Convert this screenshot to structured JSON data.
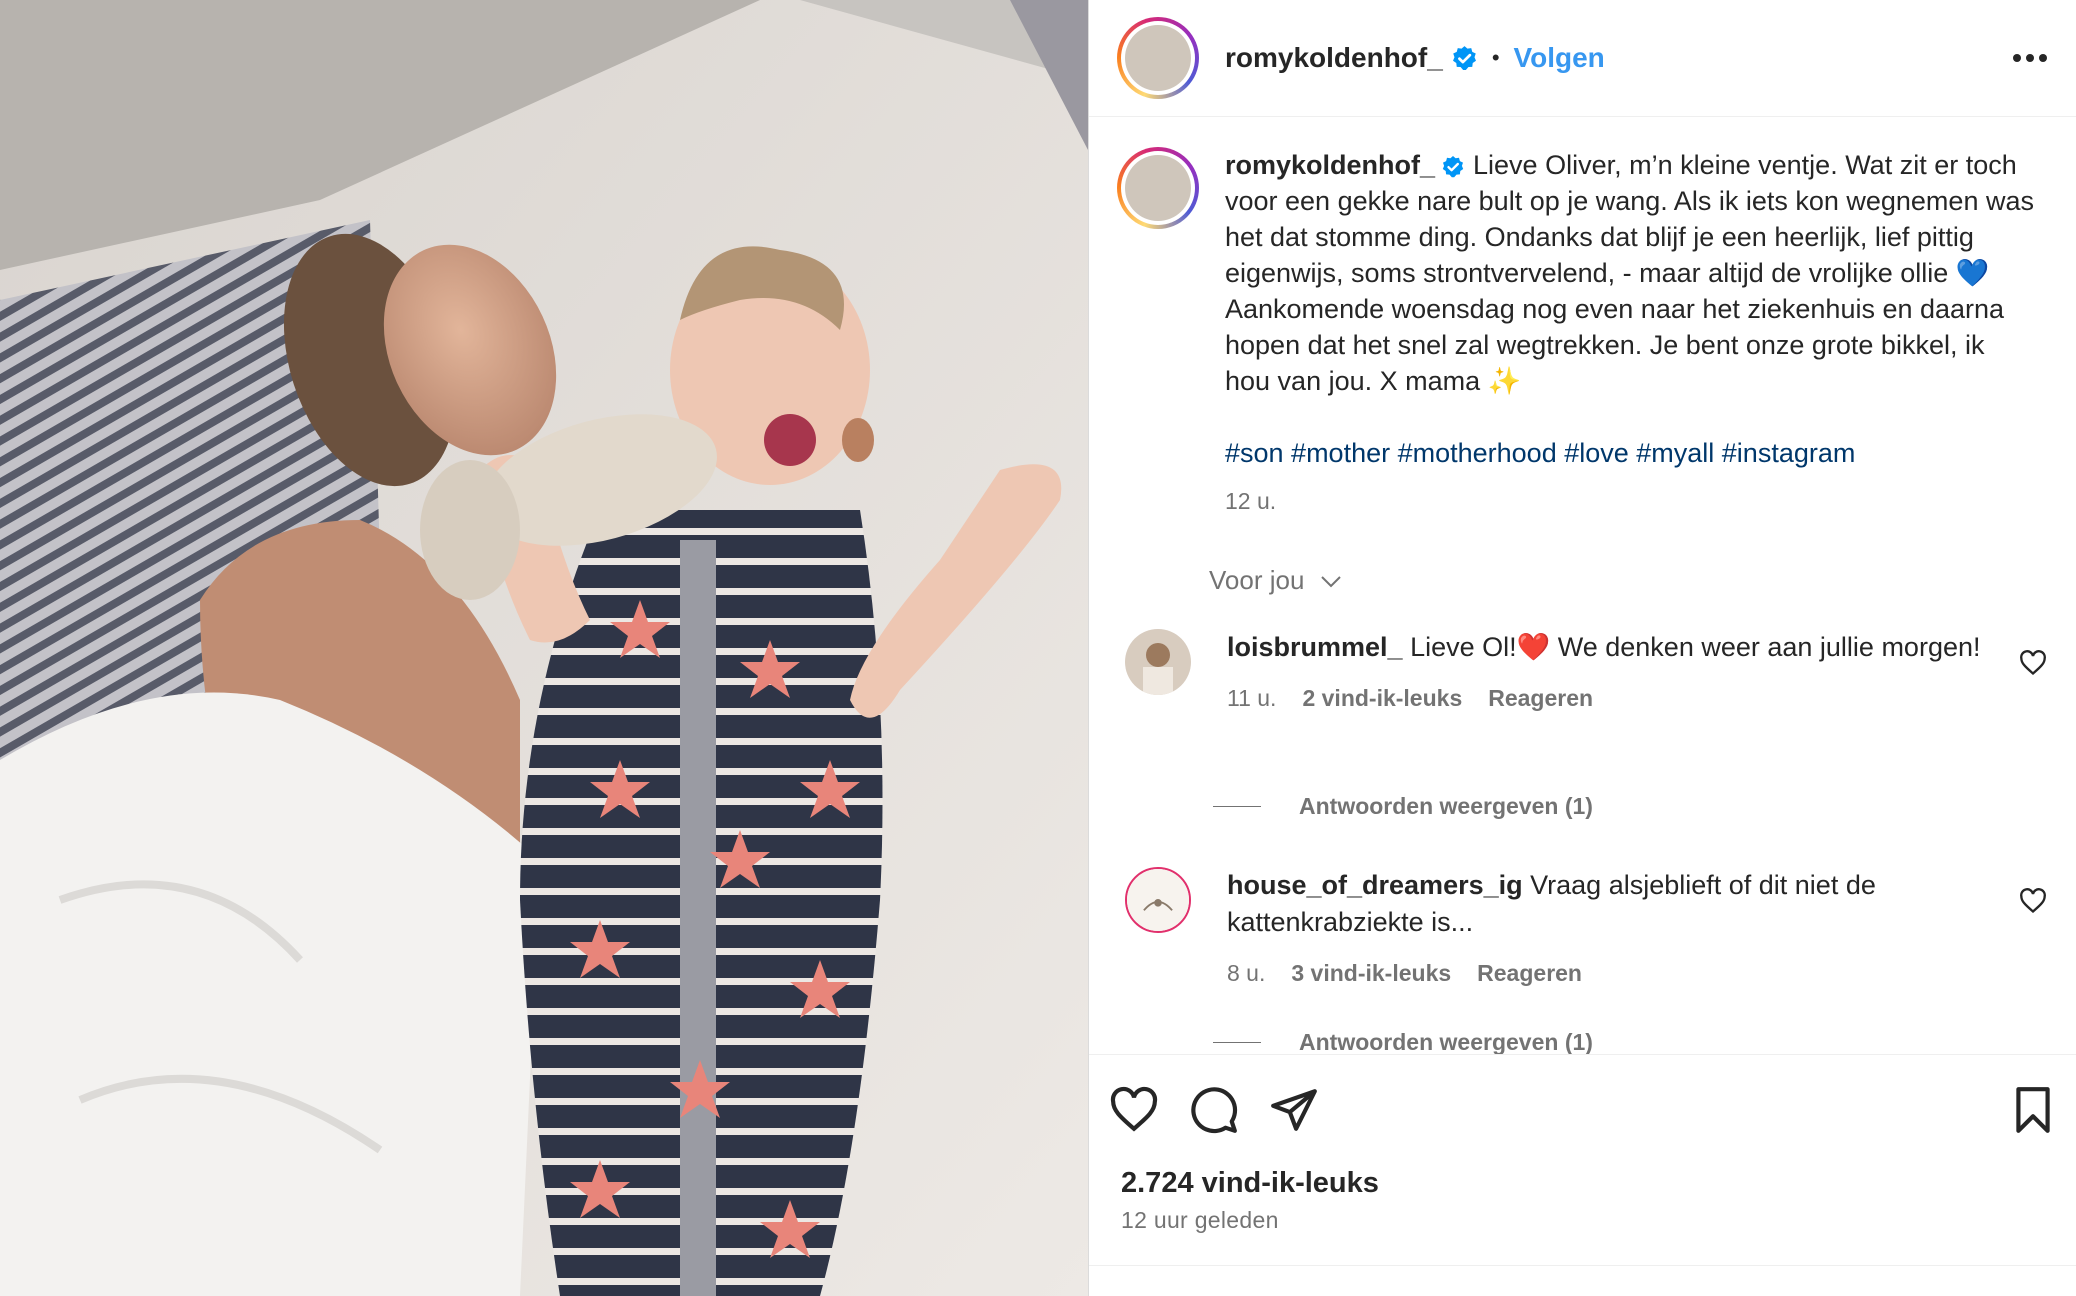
{
  "post": {
    "username": "romykoldenhof_",
    "verified": true,
    "separator": "•",
    "follow_label": "Volgen",
    "more_label": "•••"
  },
  "caption": {
    "username": "romykoldenhof_",
    "text": "Lieve Oliver, m’n kleine ventje. Wat zit er toch voor een gekke nare bult op je wang. Als ik iets kon wegnemen was het dat stomme ding. Ondanks dat blijf je een heerlijk, lief pittig eigenwijs, soms strontvervelend, - maar altijd de vrolijke ollie 💙 Aankomende woensdag nog even naar het ziekenhuis en daarna hopen dat het snel zal wegtrekken. Je bent onze grote bikkel, ik hou van jou. X mama ✨",
    "hashtags": "#son #mother #motherhood #love #myall #instagram",
    "time": "12 u."
  },
  "for_you": {
    "label": "Voor jou",
    "chevron": "⌵"
  },
  "comments": [
    {
      "username": "loisbrummel_",
      "text": "Lieve Ol!❤️ We denken weer aan jullie morgen!",
      "time": "11 u.",
      "likes": "2 vind-ik-leuks",
      "reply": "Reageren",
      "view_replies": "Antwoorden weergeven (1)"
    },
    {
      "username": "house_of_dreamers_ig",
      "text": "Vraag alsjeblieft of dit niet de kattenkrabziekte is...",
      "time": "8 u.",
      "likes": "3 vind-ik-leuks",
      "reply": "Reageren",
      "view_replies": "Antwoorden weergeven (1)"
    }
  ],
  "footer": {
    "likes": "2.724 vind-ik-leuks",
    "posted": "12 uur geleden"
  },
  "icons": {
    "like": "heart-icon",
    "comment": "comment-icon",
    "share": "share-icon",
    "save": "bookmark-icon",
    "more": "more-icon",
    "verified": "verified-badge-icon"
  },
  "colors": {
    "link_blue": "#3797f0",
    "hashtag": "#00376b",
    "muted": "#737373",
    "text": "#262626",
    "verified": "#0095f6"
  }
}
